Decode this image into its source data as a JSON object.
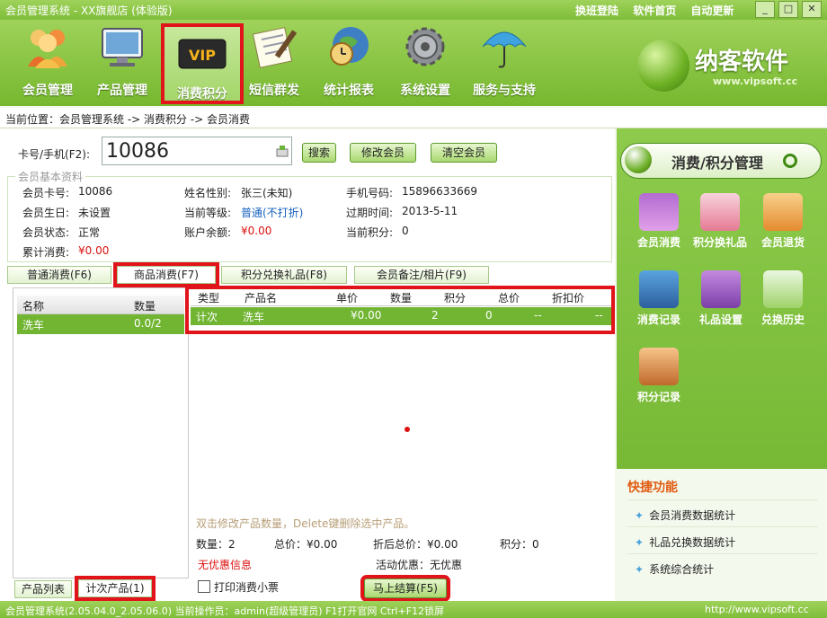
{
  "window": {
    "title": "会员管理系统 - XX旗舰店 (体验版)",
    "links": [
      "换班登陆",
      "软件首页",
      "自动更新"
    ]
  },
  "nav": [
    {
      "label": "会员管理",
      "icon": "people-icon"
    },
    {
      "label": "产品管理",
      "icon": "monitor-icon"
    },
    {
      "label": "消费积分",
      "icon": "vip-icon"
    },
    {
      "label": "短信群发",
      "icon": "notepad-icon"
    },
    {
      "label": "统计报表",
      "icon": "globe-clock-icon"
    },
    {
      "label": "系统设置",
      "icon": "gear-icon"
    },
    {
      "label": "服务与支持",
      "icon": "umbrella-icon"
    }
  ],
  "logo": {
    "name": "纳客软件",
    "url": "www.vipsoft.cc"
  },
  "breadcrumb": "当前位置：会员管理系统 -> 消费积分 -> 会员消费",
  "search": {
    "label": "卡号/手机(F2):",
    "value": "10086",
    "buttons": [
      "搜索",
      "修改会员",
      "清空会员"
    ]
  },
  "member": {
    "legend": "会员基本资料",
    "fields": {
      "card_label": "会员卡号:",
      "card": "10086",
      "name_label": "姓名性别:",
      "name": "张三(未知)",
      "phone_label": "手机号码:",
      "phone": "15896633669",
      "birthday_label": "会员生日:",
      "birthday": "未设置",
      "level_label": "当前等级:",
      "level": "普通(不打折)",
      "expire_label": "过期时间:",
      "expire": "2013-5-11",
      "status_label": "会员状态:",
      "status": "正常",
      "balance_label": "账户余额:",
      "balance": "¥0.00",
      "points_label": "当前积分:",
      "points": "0",
      "total_label": "累计消费:",
      "total": "¥0.00"
    }
  },
  "tabs": [
    "普通消费(F6)",
    "商品消费(F7)",
    "积分兑换礼品(F8)",
    "会员备注/相片(F9)"
  ],
  "left_grid": {
    "headers": [
      "名称",
      "数量"
    ],
    "rows": [
      {
        "name": "洗车",
        "qty": "0.0/2"
      }
    ]
  },
  "right_grid": {
    "headers": [
      "类型",
      "产品名",
      "单价",
      "数量",
      "积分",
      "总价",
      "折扣价"
    ],
    "rows": [
      {
        "type": "计次",
        "product": "洗车",
        "price": "¥0.00",
        "qty": "2",
        "points": "0",
        "total": "--",
        "discount": "--"
      }
    ]
  },
  "hint": "双击修改产品数量，Delete键删除选中产品。",
  "summary": {
    "qty": "数量：2",
    "total": "总价：¥0.00",
    "discount_total": "折后总价：¥0.00",
    "points": "积分：0",
    "no_promo": "无优惠信息",
    "promo": "活动优惠：无优惠"
  },
  "bottom": {
    "product_list": "产品列表",
    "count_products": "计次产品(1)",
    "print_label": "打印消费小票",
    "checkout": "马上结算(F5)"
  },
  "status": {
    "left": "会员管理系统(2.05.04.0_2.05.06.0)  当前操作员：admin(超级管理员)  F1打开官网  Ctrl+F12锁屏",
    "right": "http://www.vipsoft.cc"
  },
  "side": {
    "title": "消费/积分管理",
    "items": [
      "会员消费",
      "积分换礼品",
      "会员退货",
      "消费记录",
      "礼品设置",
      "兑换历史",
      "积分记录"
    ]
  },
  "quick": {
    "title": "快捷功能",
    "items": [
      "会员消费数据统计",
      "礼品兑换数据统计",
      "系统综合统计"
    ]
  }
}
